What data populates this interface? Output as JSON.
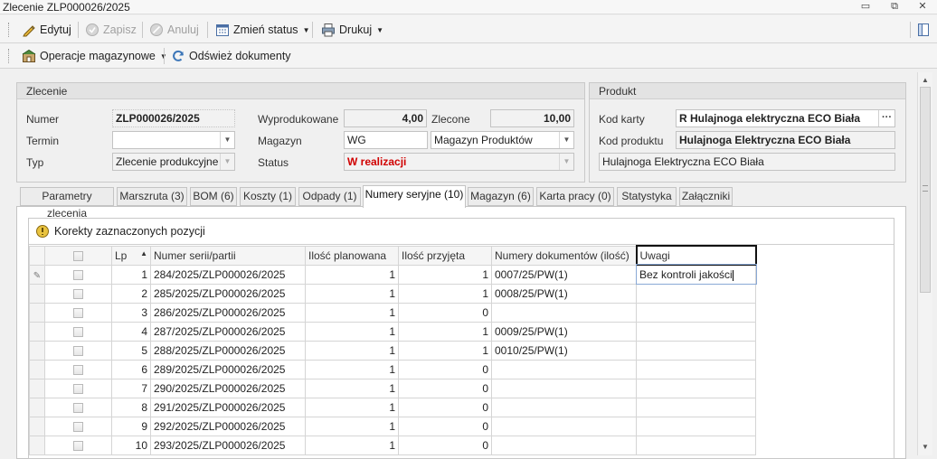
{
  "window": {
    "title": "Zlecenie ZLP000026/2025",
    "min_label": "▭",
    "max_label": "⧉",
    "close_label": "✕"
  },
  "toolbar": {
    "edit": "Edytuj",
    "save": "Zapisz",
    "cancel": "Anuluj",
    "change_status": "Zmień status",
    "print": "Drukuj"
  },
  "toolbar2": {
    "warehouse_ops": "Operacje magazynowe",
    "refresh_docs": "Odśwież dokumenty"
  },
  "zlecenie": {
    "header": "Zlecenie",
    "numer_label": "Numer",
    "numer_value": "ZLP000026/2025",
    "termin_label": "Termin",
    "termin_value": "",
    "typ_label": "Typ",
    "typ_value": "Zlecenie produkcyjne",
    "wyprodukowane_label": "Wyprodukowane",
    "wyprodukowane_value": "4,00",
    "zlecone_label": "Zlecone",
    "zlecone_value": "10,00",
    "magazyn_label": "Magazyn",
    "magazyn_code": "WG",
    "magazyn_name": "Magazyn Produktów",
    "status_label": "Status",
    "status_value": "W realizacji"
  },
  "produkt": {
    "header": "Produkt",
    "kod_karty_label": "Kod karty",
    "kod_karty_value": "R Hulajnoga elektryczna ECO Biała",
    "kod_produktu_label": "Kod produktu",
    "kod_produktu_value": "Hulajnoga Elektryczna ECO Biała",
    "nazwa_value": "Hulajnoga Elektryczna ECO Biała",
    "dots_label": "···"
  },
  "tabs": [
    {
      "label": "Parametry zlecenia"
    },
    {
      "label": "Marszruta (3)"
    },
    {
      "label": "BOM (6)"
    },
    {
      "label": "Koszty (1)"
    },
    {
      "label": "Odpady (1)"
    },
    {
      "label": "Numery seryjne (10)"
    },
    {
      "label": "Magazyn (6)"
    },
    {
      "label": "Karta pracy (0)"
    },
    {
      "label": "Statystyka"
    },
    {
      "label": "Załączniki"
    }
  ],
  "grid": {
    "toolbar_label": "Korekty zaznaczonych pozycji",
    "columns": {
      "lp": "Lp",
      "numer": "Numer serii/partii",
      "planowana": "Ilość planowana",
      "przyjeta": "Ilość przyjęta",
      "dokumenty": "Numery dokumentów (ilość)",
      "uwagi": "Uwagi"
    },
    "rows": [
      {
        "lp": "1",
        "numer": "284/2025/ZLP000026/2025",
        "planowana": "1",
        "przyjeta": "1",
        "dokumenty": "0007/25/PW(1)",
        "uwagi": "Bez kontroli jakości"
      },
      {
        "lp": "2",
        "numer": "285/2025/ZLP000026/2025",
        "planowana": "1",
        "przyjeta": "1",
        "dokumenty": "0008/25/PW(1)",
        "uwagi": ""
      },
      {
        "lp": "3",
        "numer": "286/2025/ZLP000026/2025",
        "planowana": "1",
        "przyjeta": "0",
        "dokumenty": "",
        "uwagi": ""
      },
      {
        "lp": "4",
        "numer": "287/2025/ZLP000026/2025",
        "planowana": "1",
        "przyjeta": "1",
        "dokumenty": "0009/25/PW(1)",
        "uwagi": ""
      },
      {
        "lp": "5",
        "numer": "288/2025/ZLP000026/2025",
        "planowana": "1",
        "przyjeta": "1",
        "dokumenty": "0010/25/PW(1)",
        "uwagi": ""
      },
      {
        "lp": "6",
        "numer": "289/2025/ZLP000026/2025",
        "planowana": "1",
        "przyjeta": "0",
        "dokumenty": "",
        "uwagi": ""
      },
      {
        "lp": "7",
        "numer": "290/2025/ZLP000026/2025",
        "planowana": "1",
        "przyjeta": "0",
        "dokumenty": "",
        "uwagi": ""
      },
      {
        "lp": "8",
        "numer": "291/2025/ZLP000026/2025",
        "planowana": "1",
        "przyjeta": "0",
        "dokumenty": "",
        "uwagi": ""
      },
      {
        "lp": "9",
        "numer": "292/2025/ZLP000026/2025",
        "planowana": "1",
        "przyjeta": "0",
        "dokumenty": "",
        "uwagi": ""
      },
      {
        "lp": "10",
        "numer": "293/2025/ZLP000026/2025",
        "planowana": "1",
        "przyjeta": "0",
        "dokumenty": "",
        "uwagi": ""
      }
    ]
  },
  "colors": {
    "status_red": "#d00000"
  }
}
